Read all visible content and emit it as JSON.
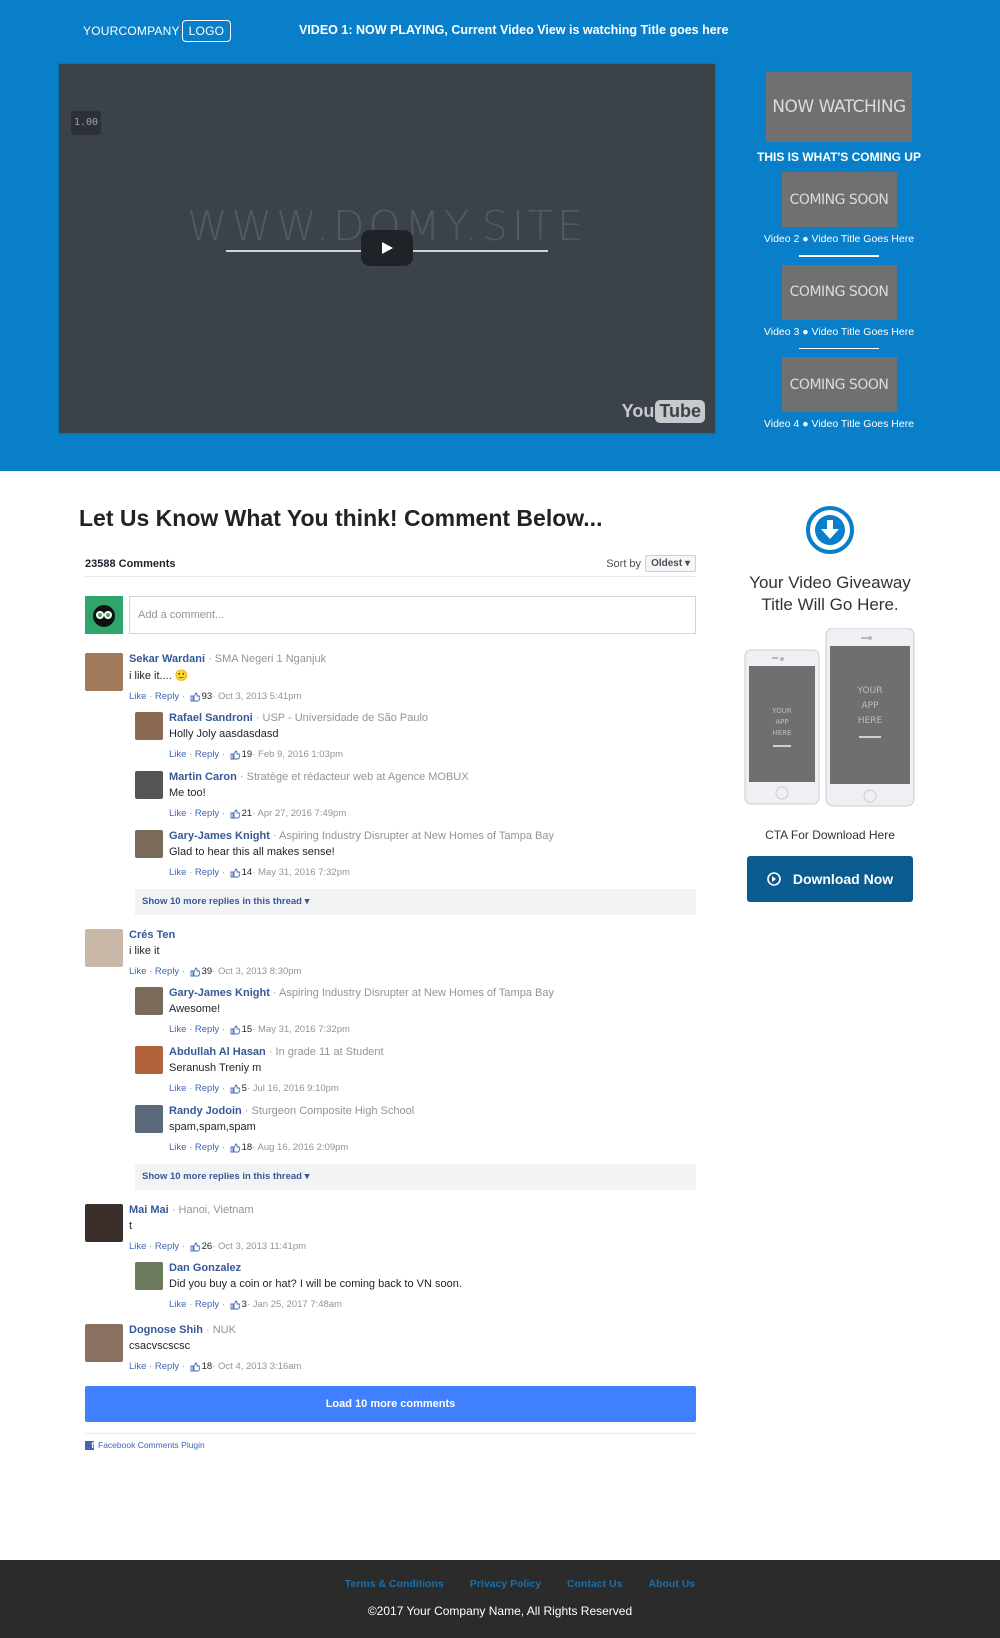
{
  "header": {
    "brand": "YOURCOMPANY",
    "logo": "LOGO",
    "now_playing": "VIDEO 1: NOW PLAYING, Current Video View is watching Title goes here"
  },
  "player": {
    "speed": "1.00",
    "watermark": "WWW.DOMY.SITE",
    "play_icon": "play-icon",
    "brand_you": "You",
    "brand_tube": "Tube"
  },
  "playlist": {
    "now_watching": "NOW WATCHING",
    "coming_up": "THIS IS WHAT'S COMING UP",
    "items": [
      {
        "thumb": "COMING SOON",
        "title": "Video 2 ● Video Title Goes Here"
      },
      {
        "thumb": "COMING SOON",
        "title": "Video 3 ● Video Title Goes Here"
      },
      {
        "thumb": "COMING SOON",
        "title": "Video 4 ● Video Title Goes Here"
      }
    ]
  },
  "comments_section": {
    "title": "Let Us Know What You think! Comment Below...",
    "count": "23588 Comments",
    "sort_label": "Sort by",
    "sort_value": "Oldest",
    "placeholder": "Add a comment...",
    "like": "Like",
    "reply": "Reply",
    "show_more": "Show 10 more replies in this thread",
    "load_more": "Load 10 more comments",
    "plugin": "Facebook Comments Plugin",
    "threads": [
      {
        "name": "Sekar Wardani",
        "meta": " · SMA Negeri 1 Nganjuk",
        "text": "i like it.... 🙂",
        "likes": "93",
        "date": " · Oct 3, 2013 5:41pm",
        "avatar_color": "#a07a5a",
        "replies": [
          {
            "name": "Rafael Sandroni",
            "meta": " · USP - Universidade de São Paulo",
            "text": "Holly Joly aasdasdasd",
            "likes": "19",
            "date": " · Feb 9, 2016 1:03pm",
            "avatar_color": "#8a6a52"
          },
          {
            "name": "Martin Caron",
            "meta": " · Stratège et rédacteur web at Agence MOBUX",
            "text": "Me too!",
            "likes": "21",
            "date": " · Apr 27, 2016 7:49pm",
            "avatar_color": "#555555"
          },
          {
            "name": "Gary-James Knight",
            "meta": " · Aspiring Industry Disrupter at New Homes of Tampa Bay",
            "text": "Glad to hear this all makes sense!",
            "likes": "14",
            "date": " · May 31, 2016 7:32pm",
            "avatar_color": "#7a6a5a"
          }
        ],
        "has_more": true
      },
      {
        "name": "Crés Ten",
        "meta": "",
        "text": "i like it",
        "likes": "39",
        "date": " · Oct 3, 2013 8:30pm",
        "avatar_color": "#c9b7a8",
        "replies": [
          {
            "name": "Gary-James Knight",
            "meta": " · Aspiring Industry Disrupter at New Homes of Tampa Bay",
            "text": "Awesome!",
            "likes": "15",
            "date": " · May 31, 2016 7:32pm",
            "avatar_color": "#7a6a5a"
          },
          {
            "name": "Abdullah Al Hasan",
            "meta": " · In grade 11 at Student",
            "text": "Seranush Treniy m",
            "likes": "5",
            "date": " · Jul 16, 2016 9:10pm",
            "avatar_color": "#b0623a"
          },
          {
            "name": "Randy Jodoin",
            "meta": " · Sturgeon Composite High School",
            "text": "spam,spam,spam",
            "likes": "18",
            "date": " · Aug 16, 2016 2:09pm",
            "avatar_color": "#5a6a7a"
          }
        ],
        "has_more": true
      },
      {
        "name": "Mai Mai",
        "meta": " · Hanoi, Vietnam",
        "text": "t",
        "likes": "26",
        "date": " · Oct 3, 2013 11:41pm",
        "avatar_color": "#3a2f2a",
        "replies": [
          {
            "name": "Dan Gonzalez",
            "meta": "",
            "text": "Did you buy a coin or hat? I will be coming back to VN soon.",
            "likes": "3",
            "date": " · Jan 25, 2017 7:48am",
            "avatar_color": "#6a7a5a"
          }
        ],
        "has_more": false
      },
      {
        "name": "Dognose Shih",
        "meta": " · NUK",
        "text": "csacvscscsc",
        "likes": "18",
        "date": " · Oct 4, 2013 3:16am",
        "avatar_color": "#8a7060",
        "replies": [],
        "has_more": false
      }
    ]
  },
  "giveaway": {
    "icon": "download-circle-icon",
    "title_line1": "Your Video Giveaway",
    "title_line2": "Title Will Go Here.",
    "phone_text_small": [
      "YOUR",
      "APP",
      "HERE"
    ],
    "phone_text_large": [
      "YOUR",
      "APP",
      "HERE"
    ],
    "cta": "CTA For Download Here",
    "button": "Download Now",
    "accent": "#0a7fc9",
    "button_color": "#0a5b8f"
  },
  "footer": {
    "links": [
      "Terms & Conditions",
      "Privacy Policy",
      "Contact Us",
      "About Us"
    ],
    "copyright": "©2017 Your Company Name, All Rights Reserved"
  }
}
